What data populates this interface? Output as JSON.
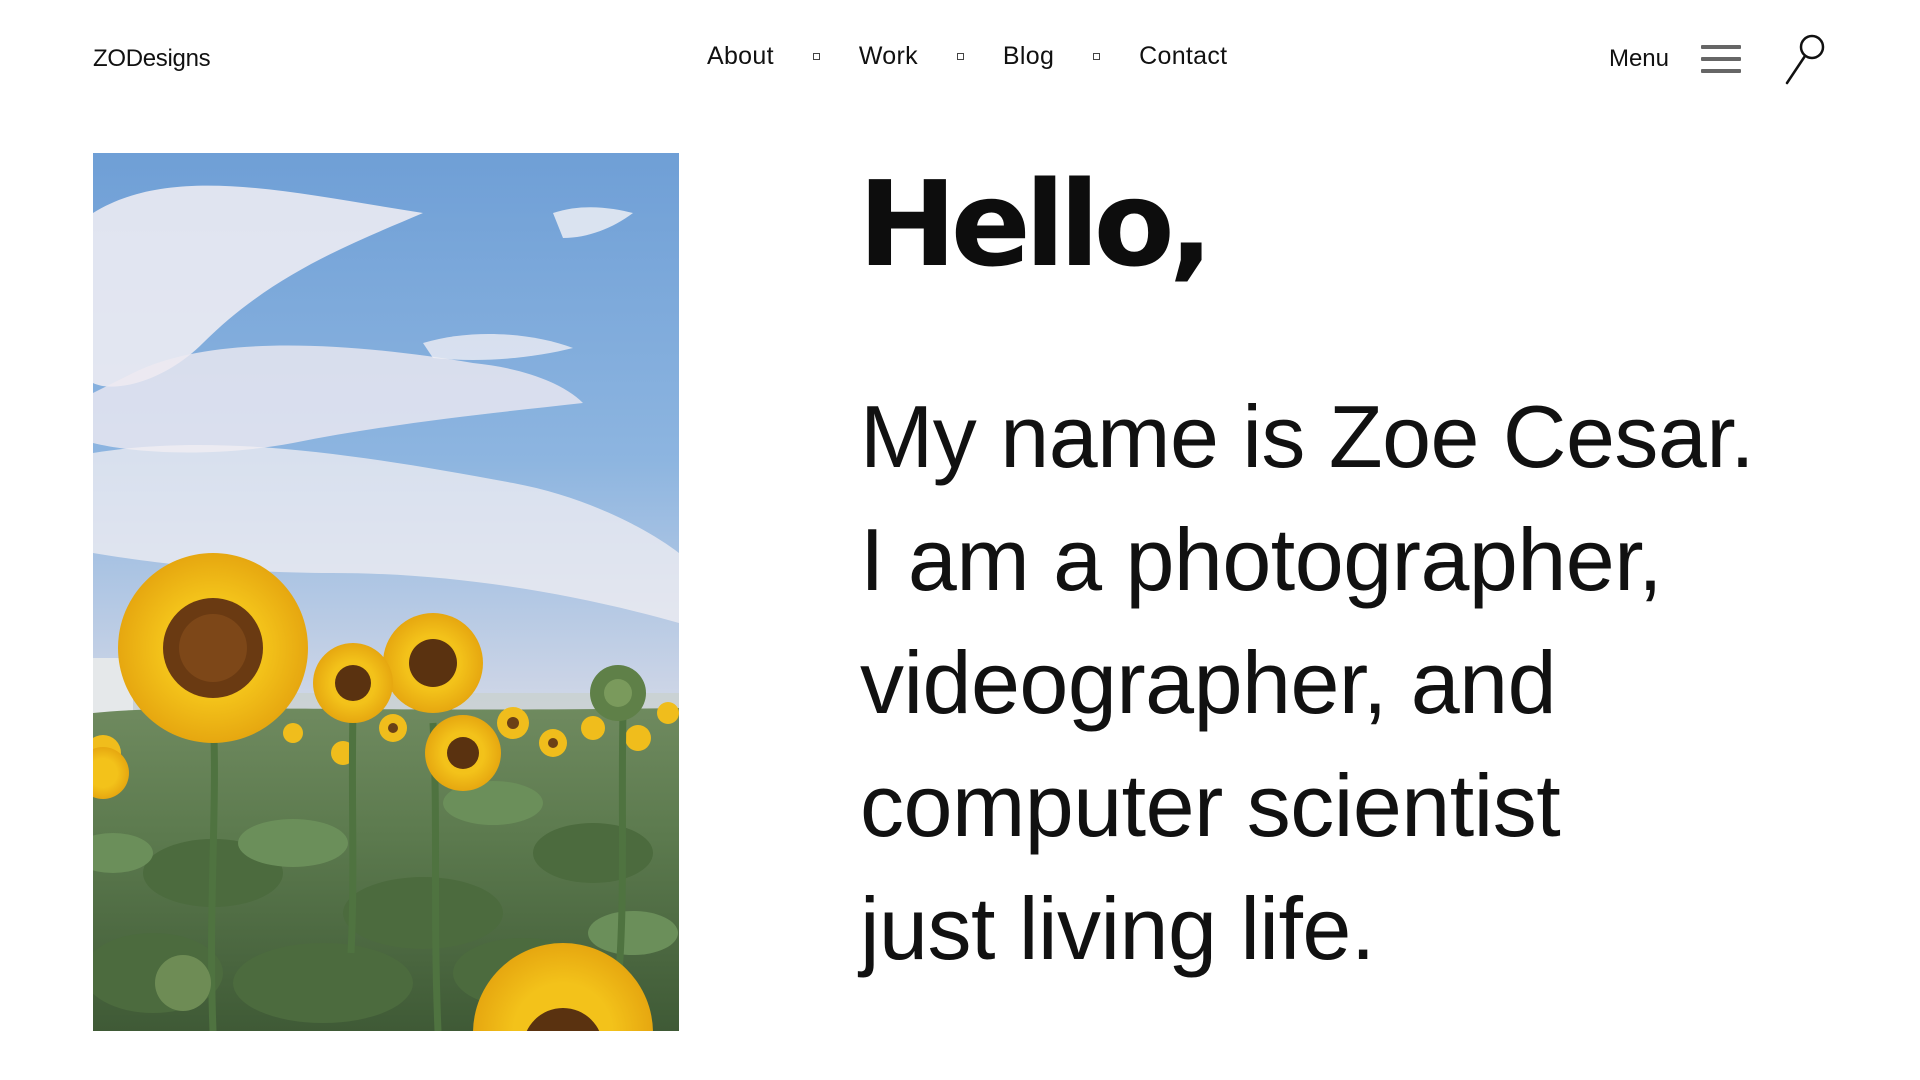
{
  "header": {
    "logo": "ZODesigns",
    "nav": [
      {
        "label": "About"
      },
      {
        "label": "Work"
      },
      {
        "label": "Blog"
      },
      {
        "label": "Contact"
      }
    ],
    "menu_label": "Menu",
    "icons": {
      "nav_separator": "square-bullet-icon",
      "menu": "hamburger-icon",
      "search": "search-icon"
    }
  },
  "hero": {
    "image": {
      "subject": "sunflower-field-photo"
    },
    "greeting": "Hello,",
    "intro_lines": [
      "My name is Zoe Cesar.",
      "I am a photographer,",
      "videographer, and",
      "computer scientist",
      "just living life."
    ]
  },
  "colors": {
    "background": "#ffffff",
    "text": "#111111",
    "hamburger": "#666666"
  }
}
